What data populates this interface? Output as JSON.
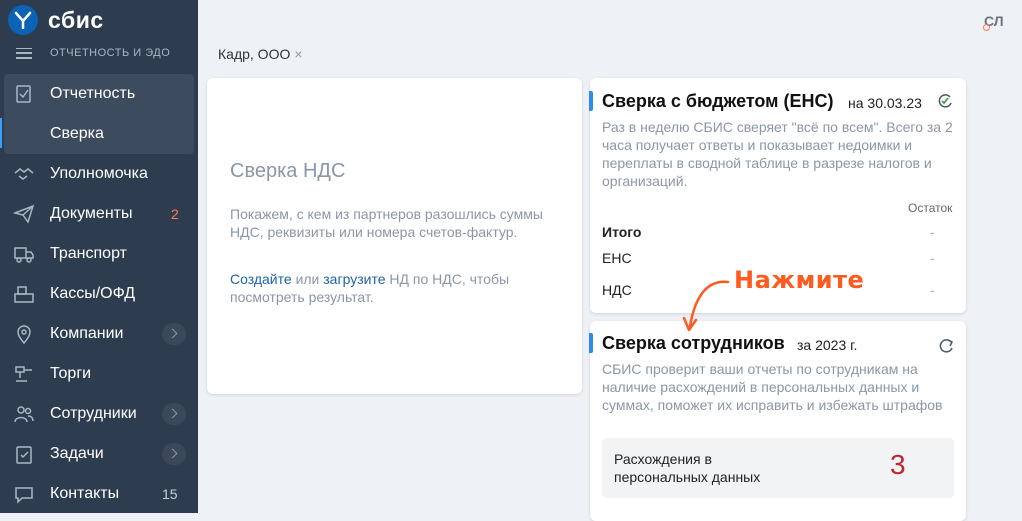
{
  "app": {
    "logo_text": "сбис",
    "section": "ОТЧЕТНОСТЬ И ЭДО",
    "user_initials": "СЛ"
  },
  "colors": {
    "sidebar_bg": "#2e3c4f",
    "accent_blue": "#2c8ee6",
    "annotation": "#ff5a1f",
    "count_red": "#c0262d"
  },
  "nav": [
    {
      "label": "Отчетность",
      "icon": "report-icon"
    },
    {
      "label": "Сверка"
    },
    {
      "label": "Уполномочка",
      "icon": "handshake-icon"
    },
    {
      "label": "Документы",
      "icon": "paper-plane-icon",
      "badge": "2"
    },
    {
      "label": "Транспорт",
      "icon": "truck-icon"
    },
    {
      "label": "Кассы/ОФД",
      "icon": "cash-register-icon"
    },
    {
      "label": "Компании",
      "icon": "map-pin-icon"
    },
    {
      "label": "Торги",
      "icon": "gavel-icon"
    },
    {
      "label": "Сотрудники",
      "icon": "people-icon"
    },
    {
      "label": "Задачи",
      "icon": "clipboard-check-icon"
    },
    {
      "label": "Контакты",
      "icon": "chat-icon",
      "badge": "15"
    }
  ],
  "breadcrumb": {
    "org": "Кадр, ООО",
    "close": "×"
  },
  "nds_card": {
    "title": "Сверка НДС",
    "description": "Покажем, с кем из партнеров разошлись суммы НДС, реквизиты или номера счетов-фактур.",
    "create_link": "Создайте",
    "or_text": "или",
    "upload_link": "загрузите",
    "rest_text": "НД по НДС, чтобы посмотреть результат."
  },
  "ens_card": {
    "title": "Сверка с бюджетом (ЕНС)",
    "date": "на 30.03.23",
    "description": "Раз в неделю СБИС сверяет \"всё по всем\". Всего за 2 часа получает ответы и показывает недоимки и переплаты в сводной таблице в разрезе налогов и организаций.",
    "column_header": "Остаток",
    "rows": [
      {
        "label": "Итого",
        "value": "-"
      },
      {
        "label": "ЕНС",
        "value": "-"
      },
      {
        "label": "НДС",
        "value": "-"
      }
    ]
  },
  "employees_card": {
    "title": "Сверка сотрудников",
    "date": "за 2023 г.",
    "description": "СБИС проверит ваши отчеты по сотрудникам на наличие расхождений в персональных данных и суммах, поможет их исправить и избежать штрафов",
    "discrepancy_label": "Расхождения в персональных данных",
    "discrepancy_count": "3"
  },
  "annotation": {
    "text": "Нажмите"
  }
}
